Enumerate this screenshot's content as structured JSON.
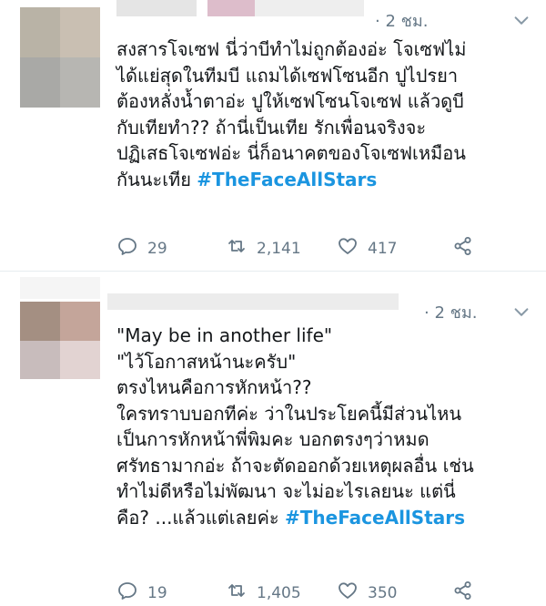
{
  "tweets": [
    {
      "time": "· 2 ชม.",
      "lines": [
        "สงสารโจเซฟ นี่ว่าบีทำไม่ถูกต้องอ่ะ โจเซฟไม่",
        "ได้แย่สุดในทีมบี แถมได้เซฟโซนอีก ปูไปรยา",
        "ต้องหลั่งน้ำตาอ่ะ ปูให้เซฟโซนโจเซฟ แล้วดูบี",
        "กับเทียทำ?? ถ้านี่เป็นเทีย รักเพื่อนจริงจะ",
        "ปฏิเสธโจเซฟอ่ะ นี่ก็อนาคตของโจเซฟเหมือน",
        "กันนะเทีย "
      ],
      "hashtag": "#TheFaceAllStars",
      "replies": "29",
      "retweets": "2,141",
      "likes": "417"
    },
    {
      "time": "· 2 ชม.",
      "lines": [
        "\"May be in another life\"",
        " \"ไว้โอกาสหน้านะครับ\"",
        "ตรงไหนคือการหักหน้า??",
        "ใครทราบบอกทีค่ะ ว่าในประโยคนี้มีส่วนไหน",
        "เป็นการหักหน้าพี่พิมคะ บอกตรงๆว่าหมด",
        "ศรัทธามากอ่ะ ถ้าจะตัดออกด้วยเหตุผลอื่น เช่น",
        "ทำไม่ดีหรือไม่พัฒนา จะไม่อะไรเลยนะ แต่นี่",
        "คือ? ...แล้วแต่เลยค่ะ "
      ],
      "hashtag": "#TheFaceAllStars",
      "replies": "19",
      "retweets": "1,405",
      "likes": "350"
    }
  ],
  "colors": {
    "hashtag": "#1b95e0",
    "muted": "#657786",
    "text": "#14171a",
    "divider": "#e6ecf0"
  },
  "icons": [
    "reply-icon",
    "retweet-icon",
    "like-icon",
    "share-icon",
    "chevron-down-icon"
  ]
}
